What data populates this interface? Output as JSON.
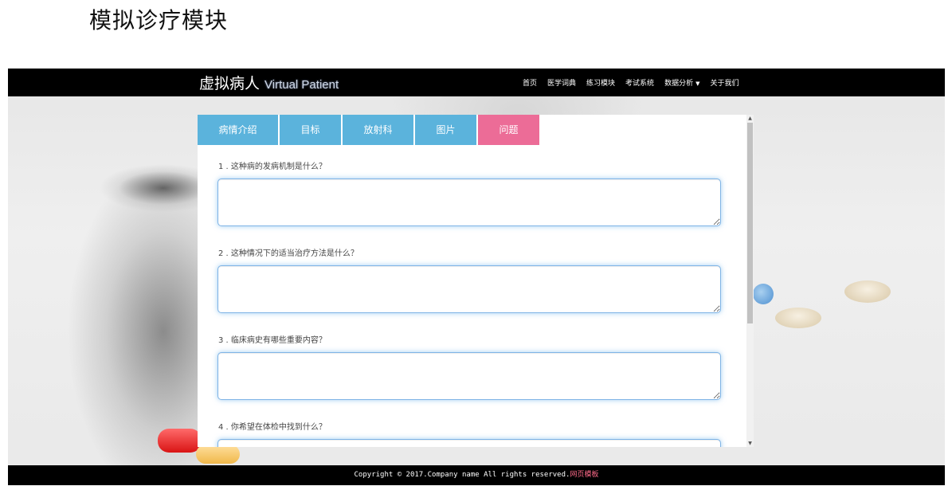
{
  "page": {
    "heading": "模拟诊疗模块"
  },
  "navbar": {
    "brand_cn": "虚拟病人",
    "brand_en": "Virtual Patient",
    "links": [
      "首页",
      "医学词典",
      "练习模块",
      "考试系统",
      "数据分析",
      "关于我们"
    ]
  },
  "tabs": {
    "items": [
      "病情介绍",
      "目标",
      "放射科",
      "图片",
      "问题"
    ],
    "active": "问题"
  },
  "questions": [
    {
      "label": "1 . 这种病的发病机制是什么？",
      "value": ""
    },
    {
      "label": "2 . 这种情况下的适当治疗方法是什么？",
      "value": ""
    },
    {
      "label": "3 . 临床病史有哪些重要内容？",
      "value": ""
    },
    {
      "label": "4 . 你希望在体检中找到什么？",
      "value": ""
    }
  ],
  "footer": {
    "copyright": "Copyright © 2017.Company name All rights reserved.",
    "link": "网页模板"
  },
  "colors": {
    "tab": "#5bb3dc",
    "tab_active": "#ec6c97",
    "navbar": "#000000",
    "textarea_border": "#7fb4e6"
  },
  "icons": {
    "dropdown": "caret-down-icon",
    "scroll_up": "scroll-up-arrow-icon",
    "scroll_down": "scroll-down-arrow-icon"
  }
}
